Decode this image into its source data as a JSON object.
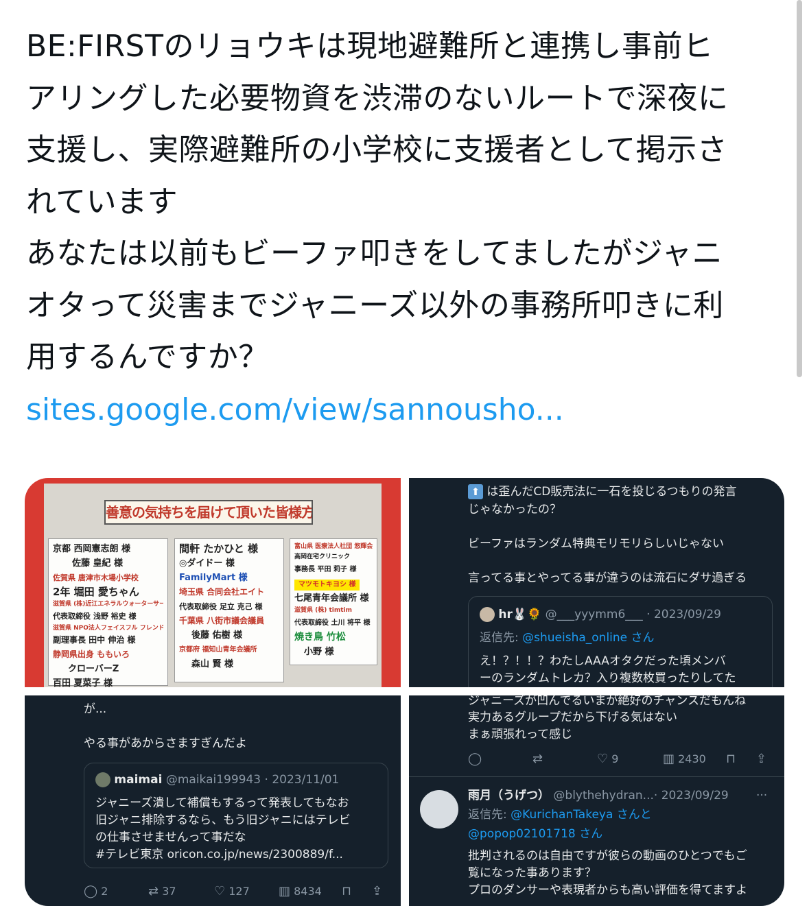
{
  "tweet": {
    "text_lines": [
      "BE:FIRSTのリョウキは現地避難所と連携し事前ヒ",
      "アリングした必要物資を渋滞のないルートで深夜に",
      "支援し、実際避難所の小学校に支援者として掲示さ",
      "れています",
      "あなたは以前もビーファ叩きをしてましたがジャニ",
      "オタって災害までジャニーズ以外の事務所叩きに利",
      "用するんですか？"
    ],
    "link": "sites.google.com/view/sannousho..."
  },
  "photo": {
    "board_title": "善意の気持ちを届けて頂いた皆様方",
    "col1": [
      "京都 西岡憲志朗 様",
      "佐藤 皇紀 様",
      "佐賀県 唐津市木場小学校",
      "2年 堀田 愛ちゃん",
      "滋賀県 (株)近江エネラルウォーターサービス",
      "代表取締役 浅野 裕史 様",
      "滋賀県 NPO法人フェイスフル フレンド ソサエティ",
      "副理事長 田中 伸治 様",
      "静岡県出身 ももいろ",
      "クローバーZ",
      "百田 夏菜子 様"
    ],
    "col2": [
      "間軒 たかひと 様",
      "◎ダイドー 様",
      "FamilyMart 様",
      "埼玉県 合同会社エイト",
      "代表取締役 足立 克己 様",
      "千葉県 八街市議会議員",
      "後藤 佑樹 様",
      "京都府 福知山青年会議所",
      "森山 賢 様"
    ],
    "col3": [
      "富山県 医療法人社団 悠輝会",
      "高岡在宅クリニック",
      "事務長 平田 莉子 様",
      "マツモトキヨシ 様",
      "七尾青年会議所 様",
      "滋賀県 (株) timtim",
      "代表取締役 土川 将平 様",
      "焼き鳥 竹松",
      "小野 様"
    ]
  },
  "tr": {
    "line1": "は歪んだCD販売法に一石を投じるつもりの発言",
    "line2": "じゃなかったの？",
    "line3": "ビーファはランダム特典モリモリらしいじゃない",
    "line4": "言ってる事とやってる事が違うのは流石にダサ過ぎる",
    "quote_name": "hr🐰🌻",
    "quote_handle": "@___yyymm6___",
    "quote_date": "· 2023/09/29",
    "reply_to_label": "返信先:",
    "reply_to_user": "@shueisha_online さん",
    "quote_line1": "え！？！！？わたしAAAオタクだった頃メンバ",
    "quote_line2": "ーのランダムトレカ？入り複数枚買ったりしてた"
  },
  "bl": {
    "cut_line": "が...",
    "line2": "やる事があからさますぎんだよ",
    "quote_name": "maimai",
    "quote_handle": "@maikai199943",
    "quote_date": "· 2023/11/01",
    "quote_line1": "ジャニーズ潰して補償もするって発表してもなお",
    "quote_line2": "旧ジャニ排除するなら、もう旧ジャニにはテレビ",
    "quote_line3": "の仕事させませんって事だな",
    "quote_line4": "#テレビ東京 oricon.co.jp/news/2300889/f...",
    "replies": "2",
    "retweets": "37",
    "likes": "127",
    "views": "8434"
  },
  "br": {
    "line1": "ジャニーズが凹んでるいまが絶好のチャンスだもんね",
    "line2": "実力あるグループだから下げる気はない",
    "line3": "まぁ頑張れって感じ",
    "likes": "9",
    "views": "2430",
    "name": "雨月（うげつ）",
    "handle": "@blythehydran...",
    "date": "· 2023/09/29",
    "more": "···",
    "reply_to_label": "返信先:",
    "reply_to_user1": "@KurichanTakeya さんと",
    "reply_to_user2": "@popop02101718 さん",
    "body1": "批判されるのは自由ですが彼らの動画のひとつでもご",
    "body2": "覧になった事あります？",
    "body3": "プロのダンサーや表現者からも高い評価を得てますよ"
  }
}
